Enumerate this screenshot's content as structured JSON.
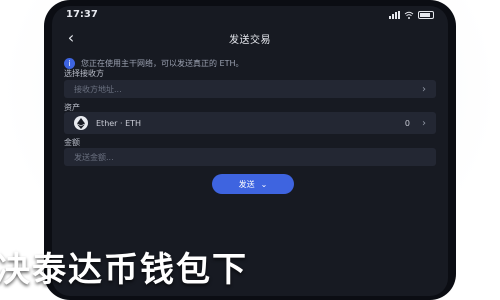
{
  "status_bar": {
    "time": "17:37"
  },
  "nav": {
    "back_label": "‹",
    "title": "发送交易"
  },
  "notice": {
    "icon_name": "info-icon",
    "text": "您正在使用主干网络，可以发送真正的 ETH。"
  },
  "recipient": {
    "label": "选择接收方",
    "placeholder": "接收方地址..."
  },
  "asset": {
    "label": "资产",
    "name": "Ether · ETH",
    "balance": "0",
    "icon_name": "eth-logo-icon"
  },
  "amount": {
    "label": "金额",
    "placeholder": "发送金额..."
  },
  "send_button": {
    "label": "发送",
    "icon_name": "chevron-down-icon"
  },
  "overlay": {
    "text": "决泰达币钱包下"
  },
  "colors": {
    "accent": "#3e64e0",
    "background": "#171a22",
    "field": "#232733"
  }
}
